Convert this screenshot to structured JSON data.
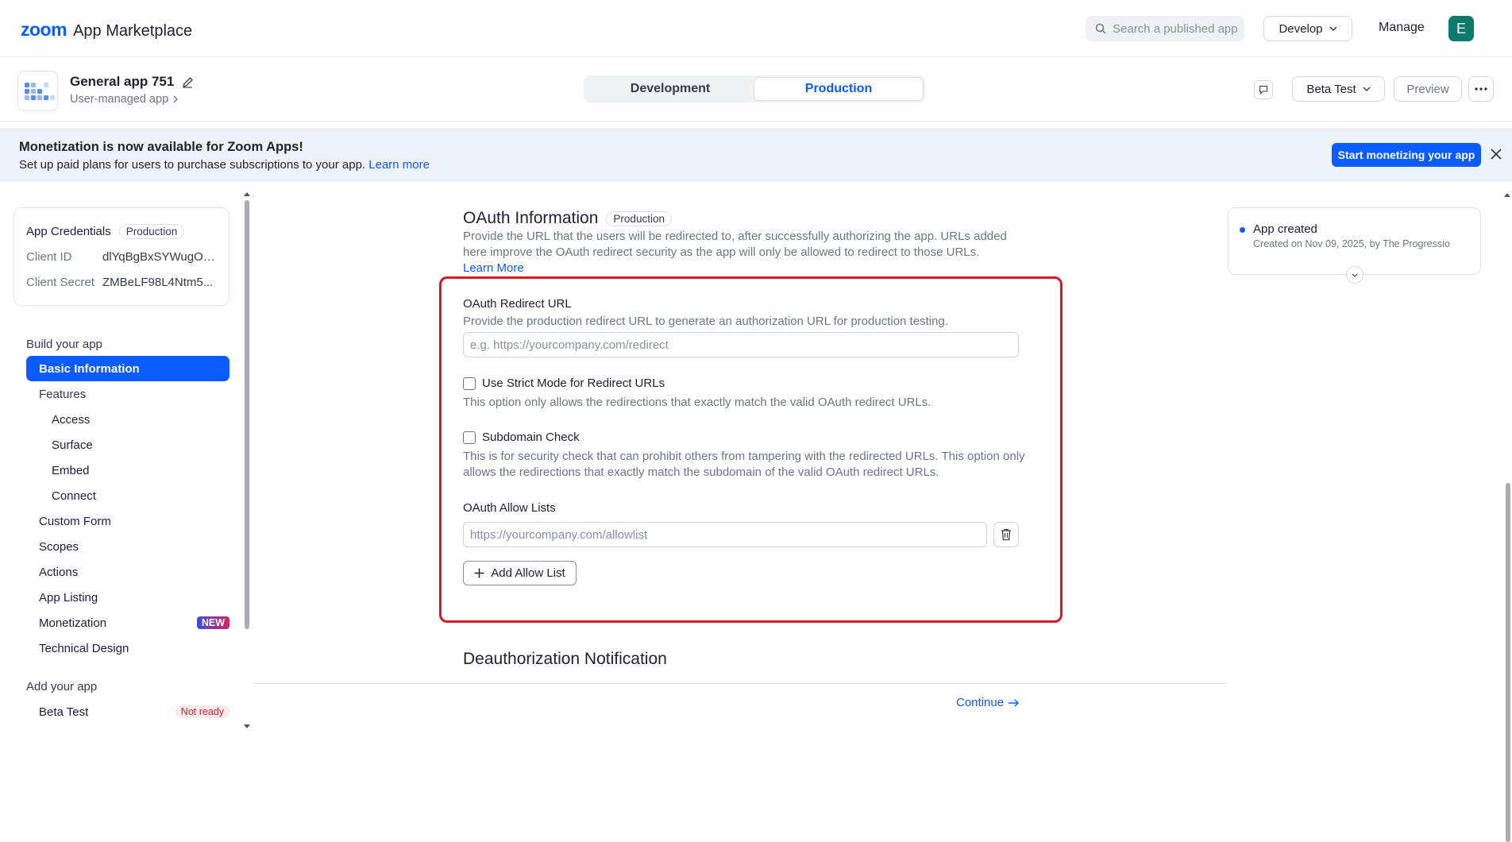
{
  "header": {
    "logo_zoom": "zoom",
    "logo_text": "App Marketplace",
    "search_placeholder": "Search a published app",
    "develop_label": "Develop",
    "manage_label": "Manage",
    "avatar_letter": "E"
  },
  "appbar": {
    "app_name": "General app 751",
    "app_type": "User-managed app",
    "env_tabs": [
      "Development",
      "Production"
    ],
    "active_env": "Production",
    "beta_label": "Beta Test",
    "preview_label": "Preview"
  },
  "banner": {
    "title": "Monetization is now available for Zoom Apps!",
    "text": "Set up paid plans for users to purchase subscriptions to your app.",
    "link": "Learn more",
    "button": "Start monetizing your app"
  },
  "sidebar": {
    "credentials": {
      "title": "App Credentials",
      "env": "Production",
      "client_id_label": "Client ID",
      "client_id_value": "dlYqBgBxSYWugOp...",
      "client_secret_label": "Client Secret",
      "client_secret_value": "ZMBeLF98L4Ntm5..."
    },
    "build_heading": "Build your app",
    "items": [
      {
        "label": "Basic Information"
      },
      {
        "label": "Features"
      },
      {
        "label": "Access"
      },
      {
        "label": "Surface"
      },
      {
        "label": "Embed"
      },
      {
        "label": "Connect"
      },
      {
        "label": "Custom Form"
      },
      {
        "label": "Scopes"
      },
      {
        "label": "Actions"
      },
      {
        "label": "App Listing"
      },
      {
        "label": "Monetization",
        "badge": "NEW"
      },
      {
        "label": "Technical Design"
      }
    ],
    "add_heading": "Add your app",
    "add_items": [
      {
        "label": "Beta Test",
        "badge": "Not ready"
      }
    ]
  },
  "main": {
    "title": "OAuth Information",
    "title_badge": "Production",
    "description": "Provide the URL that the users will be redirected to, after successfully authorizing the app. URLs added here improve the OAuth redirect security as the app will only be allowed to redirect to those URLs.",
    "learn_more": "Learn More",
    "redirect_label": "OAuth Redirect URL",
    "redirect_help": "Provide the production redirect URL to generate an authorization URL for production testing.",
    "redirect_placeholder": "e.g. https://yourcompany.com/redirect",
    "strict_label": "Use Strict Mode for Redirect URLs",
    "strict_help": "This option only allows the redirections that exactly match the valid OAuth redirect URLs.",
    "subdomain_label": "Subdomain Check",
    "subdomain_help": "This is for security check that can prohibit others from tampering with the redirected URLs. This option only allows the redirections that exactly match the subdomain of the valid OAuth redirect URLs.",
    "allow_label": "OAuth Allow Lists",
    "allow_placeholder": "https://yourcompany.com/allowlist",
    "add_allow_label": "Add Allow List",
    "deauth_title": "Deauthorization Notification",
    "continue_label": "Continue"
  },
  "activity": {
    "title": "App created",
    "subtitle": "Created on Nov 09, 2025, by The Progressio"
  },
  "colors": {
    "accent": "#0b5cff",
    "highlight_border": "#d11b28",
    "avatar_bg": "#0d7a6e"
  }
}
